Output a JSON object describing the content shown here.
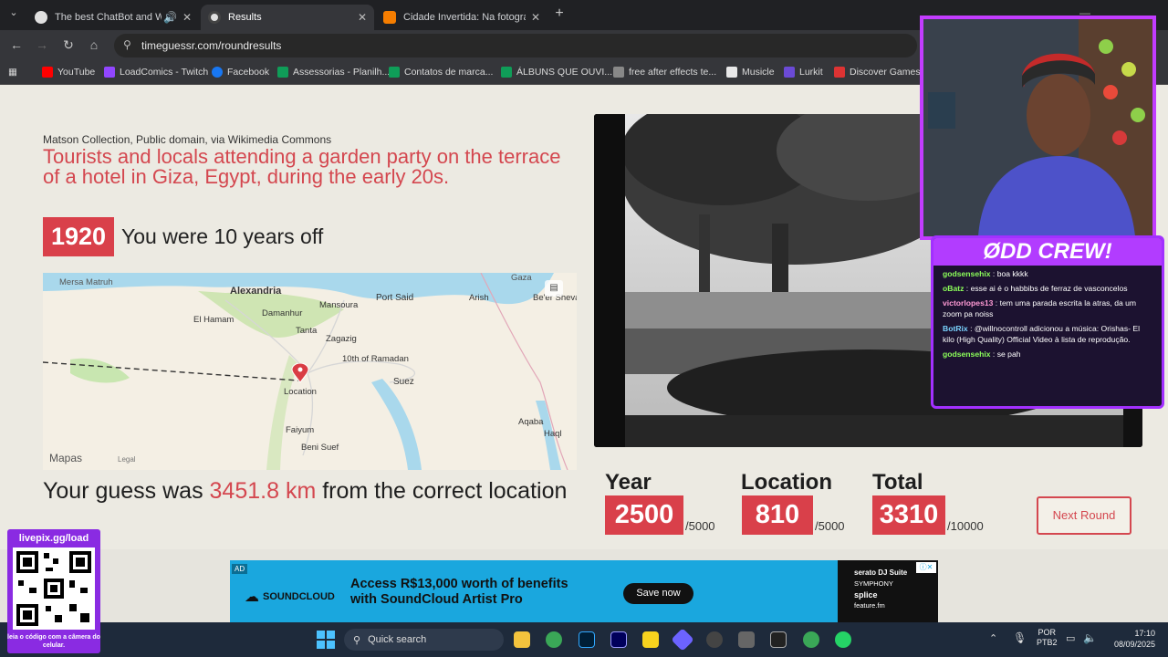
{
  "browser": {
    "tabs": [
      {
        "title": "The best ChatBot and Widg",
        "active": false
      },
      {
        "title": "Results",
        "active": true
      },
      {
        "title": "Cidade Invertida: Na fotografia",
        "active": false
      }
    ],
    "url": "timeguessr.com/roundresults",
    "bookmarks": [
      "YouTube",
      "LoadComics - Twitch",
      "Facebook",
      "Assessorias - Planilh...",
      "Contatos de marca...",
      "ÁLBUNS QUE OUVI...",
      "free after effects te...",
      "Musicle",
      "Lurkit",
      "Discover Games -"
    ]
  },
  "result": {
    "credit": "Matson Collection, Public domain, via Wikimedia Commons",
    "description": "Tourists and locals attending a garden party on the terrace of a hotel in Giza, Egypt, during the early 20s.",
    "year": "1920",
    "year_feedback": "You were 10 years off",
    "guess_prefix": "Your guess was ",
    "guess_distance": "3451.8 km",
    "guess_suffix": " from the correct location"
  },
  "map": {
    "labels": {
      "mersa_matruh": "Mersa Matruh",
      "alexandria": "Alexandria",
      "port_said": "Port Said",
      "gaza": "Gaza",
      "el_hamam": "El Hamam",
      "damanhur": "Damanhur",
      "mansoura": "Mansoura",
      "arish": "Arish",
      "be_er_sheva": "Be'er Sheva",
      "tanta": "Tanta",
      "zagazig": "Zagazig",
      "tenth_ramadan": "10th of Ramadan",
      "suez": "Suez",
      "location": "Location",
      "faiyum": "Faiyum",
      "beni_suef": "Beni Suef",
      "aqaba": "Aqaba",
      "haql": "Haql"
    },
    "brand": "Mapas",
    "legal": "Legal"
  },
  "scores": {
    "year": {
      "label": "Year",
      "value": "2500",
      "max": "/5000"
    },
    "location": {
      "label": "Location",
      "value": "810",
      "max": "/5000"
    },
    "total": {
      "label": "Total",
      "value": "3310",
      "max": "/10000"
    },
    "next_label": "Next Round"
  },
  "ad": {
    "brand": "SOUNDCLOUD",
    "headline_1": "Access R$13,000 worth of benefits",
    "headline_2": "with SoundCloud Artist Pro",
    "cta": "Save now",
    "partners": [
      "serato DJ Suite",
      "SYMPHONY",
      "splice",
      "feature.fm"
    ],
    "ad_badge": "AD"
  },
  "overlay": {
    "crew_title": "ØDD CREW!",
    "chat": [
      {
        "user": "godsensehix",
        "text": " : boa kkkk",
        "color": "#8cff5a"
      },
      {
        "user": "oBatz",
        "text": " : esse ai é o habbibs de ferraz de vasconcelos",
        "color": "#8cff5a"
      },
      {
        "user": "victorlopes13",
        "text": " : tem uma parada escrita la atras, da um zoom pa noiss",
        "color": "#ff9ad5"
      },
      {
        "user": "BotRix",
        "text": " : @willnocontroll adicionou a música: Orishas- El kilo (High Quality) Official Video à lista de reprodução.",
        "color": "#7ad3ff"
      },
      {
        "user": "godsensehix",
        "text": " : se pah",
        "color": "#8cff5a"
      }
    ],
    "qr_title": "livepix.gg/load",
    "qr_caption": "leia o código com a câmera do celular."
  },
  "taskbar": {
    "search_label": "Quick search",
    "lang_1": "POR",
    "lang_2": "PTB2",
    "time": "17:10",
    "date": "08/09/2025"
  }
}
